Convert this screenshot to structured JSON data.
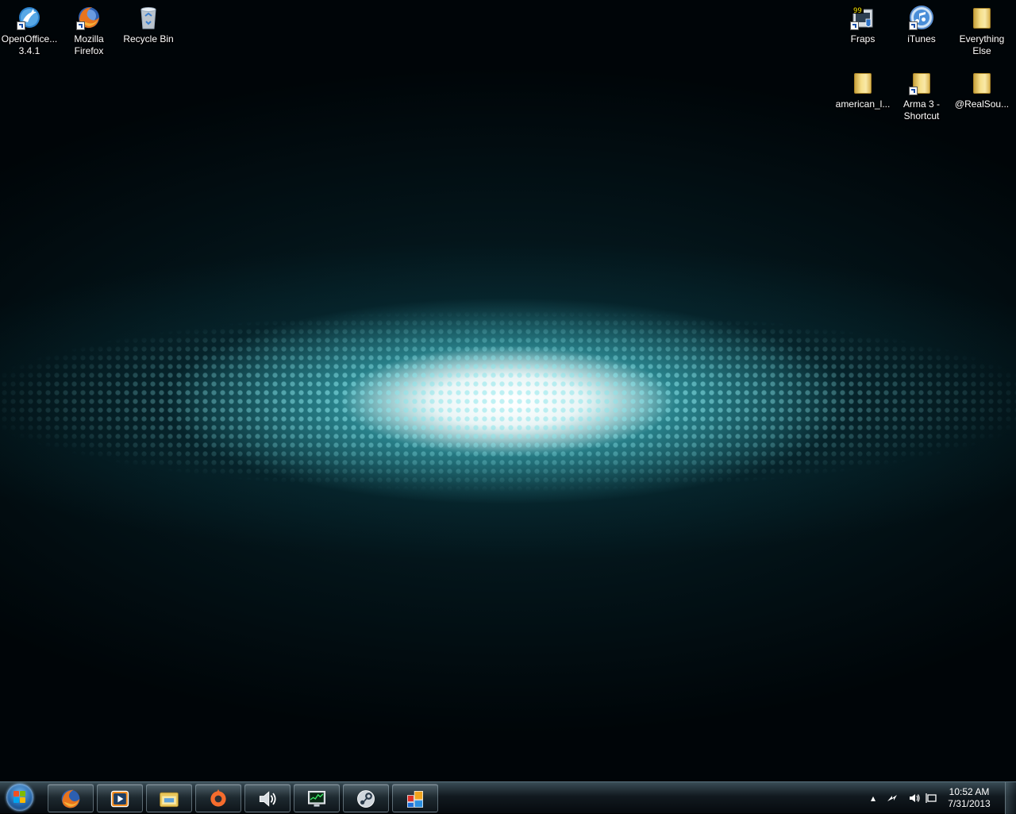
{
  "desktop": {
    "icons": [
      {
        "label": "OpenOffice... 3.4.1",
        "icon": "openoffice-icon"
      },
      {
        "label": "Mozilla Firefox",
        "icon": "firefox-icon"
      },
      {
        "label": "Recycle Bin",
        "icon": "recycle-bin-icon"
      },
      {
        "label": "Fraps",
        "icon": "fraps-icon",
        "badge": "99"
      },
      {
        "label": "iTunes",
        "icon": "itunes-icon"
      },
      {
        "label": "Everything Else",
        "icon": "folder-icon"
      },
      {
        "label": "american_l...",
        "icon": "folder-icon"
      },
      {
        "label": "Arma 3 - Shortcut",
        "icon": "arma3-icon"
      },
      {
        "label": "@RealSou...",
        "icon": "folder-icon"
      }
    ]
  },
  "taskbar": {
    "start": {
      "icon": "windows-start-orb-icon"
    },
    "pinned": [
      {
        "icon": "firefox-icon"
      },
      {
        "icon": "media-player-icon"
      },
      {
        "icon": "file-explorer-icon"
      },
      {
        "icon": "origin-icon"
      },
      {
        "icon": "speaker-app-icon"
      },
      {
        "icon": "task-manager-icon"
      },
      {
        "icon": "steam-icon"
      },
      {
        "icon": "windows-tiles-icon"
      }
    ],
    "tray": {
      "icons": [
        "show-hidden-icons-chevron-icon",
        "network-arrow-icon",
        "volume-icon",
        "action-center-flag-icon"
      ],
      "time": "10:52 AM",
      "date": "7/31/2013"
    }
  },
  "colors": {
    "glow": "#ffffff",
    "teal": "#3fb3ba",
    "background": "#000508",
    "folder": "#f6df8a",
    "accent_blue": "#2564a8"
  }
}
